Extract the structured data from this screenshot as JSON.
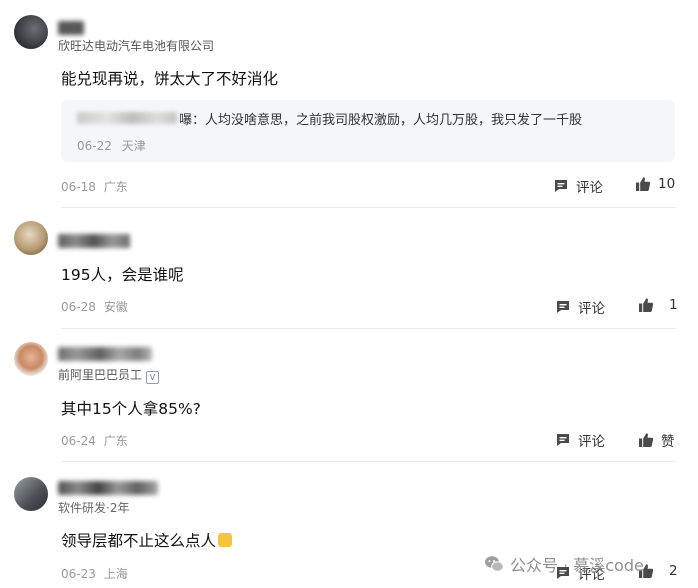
{
  "comments": [
    {
      "org": "欣旺达电动汽车电池有限公司",
      "text": "能兑现再说，饼太大了不好消化",
      "reply": {
        "text": "嚗：人均没啥意思，之前我司股权激励，人均几万股，我只发了一千股",
        "date": "06-22",
        "location": "天津"
      },
      "date": "06-18",
      "location": "广东",
      "reply_label": "评论",
      "likes": "10"
    },
    {
      "text": "195人，会是谁呢",
      "date": "06-28",
      "location": "安徽",
      "reply_label": "评论",
      "likes": "1"
    },
    {
      "org": "前阿里巴巴员工",
      "text": "其中15个人拿85%?",
      "date": "06-24",
      "location": "广东",
      "reply_label": "评论",
      "likes": "赞"
    },
    {
      "org": "软件研发·2年",
      "text": "领导层都不止这么点人",
      "date": "06-23",
      "location": "上海",
      "reply_label": "评论",
      "likes": "2"
    }
  ],
  "watermark": "公众号 · 慕溪code",
  "colors": {
    "icon": "#4a4a4a",
    "muted": "#999999",
    "divider": "#ececec",
    "reply_bg": "#f5f6f8"
  },
  "icons": {
    "reply": "comment-icon",
    "like": "thumbs-up-icon",
    "verified": "verified-badge-icon",
    "emoji": "emoji-icon"
  }
}
